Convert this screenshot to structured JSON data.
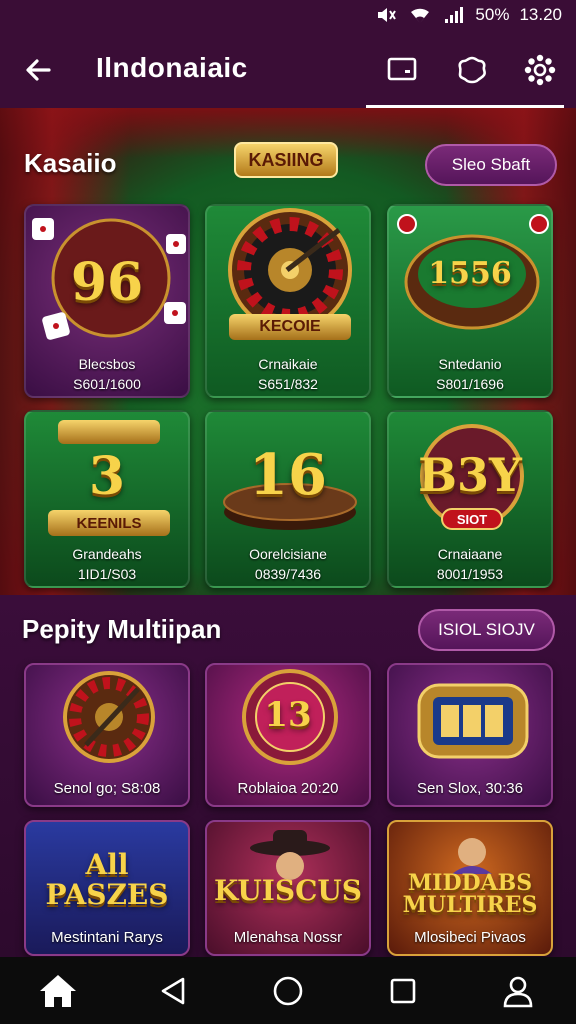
{
  "status": {
    "battery": "50%",
    "time": "13.20"
  },
  "app_bar": {
    "title": "Ilndonaiaic"
  },
  "casino": {
    "section_title": "Kasaiio",
    "action_label": "Sleo Sbaft",
    "logo_text": "KASIING",
    "games": [
      {
        "art_text": "96",
        "name": "Blecsbos",
        "stat": "S601/1600"
      },
      {
        "art_text": "",
        "badge": "KECOIE",
        "name": "Crnaikaie",
        "stat": "S651/832"
      },
      {
        "art_text": "1556",
        "name": "Sntedanio",
        "stat": "S801/1696"
      },
      {
        "art_text": "3",
        "badge": "KEENILS",
        "name": "Grandeahs",
        "stat": "1ID1/S03"
      },
      {
        "art_text": "16",
        "name": "Oorelcisiane",
        "stat": "0839/7436"
      },
      {
        "art_text": "B3Y",
        "badge": "SIOT",
        "name": "Crnaiaane",
        "stat": "8001/1953"
      }
    ]
  },
  "multi": {
    "section_title": "Pepity Multiipan",
    "action_label": "ISIOL SIOJV",
    "games": [
      {
        "art_text": "",
        "caption": "Senol go; S8:08"
      },
      {
        "art_text": "13",
        "caption": "Roblaioa 20:20"
      },
      {
        "art_text": "",
        "caption": "Sen Slox, 30:36"
      },
      {
        "art_text": "All PASZES",
        "caption": "Mestintani Rarys"
      },
      {
        "art_text": "KUISCUS",
        "caption": "Mlenahsa Nossr"
      },
      {
        "art_text": "MIDDABS MULTIRES",
        "caption": "Mlosibeci Pivaos"
      }
    ]
  },
  "colors": {
    "accent": "#f7d34a",
    "felt": "#1f7a2e",
    "bar": "#3a0d36",
    "pill": "#7a2a78"
  }
}
